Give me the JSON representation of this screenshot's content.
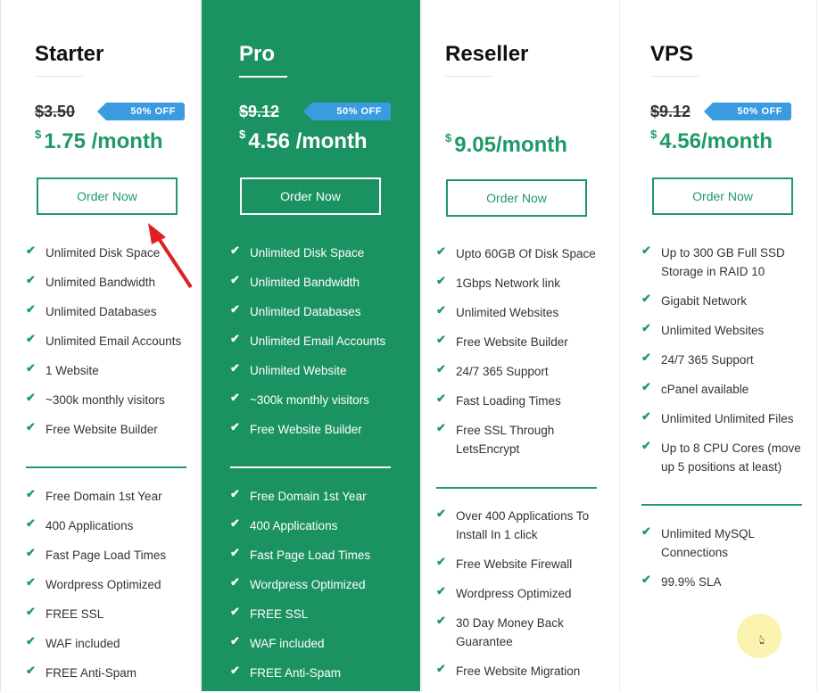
{
  "plans": [
    {
      "title": "Starter",
      "old_price": "$3.50",
      "badge": "50% OFF",
      "currency": "$",
      "price": "1.75 /month",
      "button": "Order Now",
      "features": [
        "Unlimited Disk Space",
        "Unlimited Bandwidth",
        "Unlimited Databases",
        "Unlimited Email Accounts",
        "1 Website",
        "~300k monthly visitors",
        "Free Website Builder"
      ],
      "extras": [
        "Free Domain 1st Year",
        "400 Applications",
        "Fast Page Load Times",
        "Wordpress Optimized",
        "FREE SSL",
        "WAF included",
        "FREE Anti-Spam"
      ]
    },
    {
      "title": "Pro",
      "old_price": "$9.12",
      "badge": "50% OFF",
      "currency": "$",
      "price": "4.56 /month",
      "button": "Order Now",
      "features": [
        "Unlimited Disk Space",
        "Unlimited Bandwidth",
        "Unlimited Databases",
        "Unlimited Email Accounts",
        "Unlimited Website",
        "~300k monthly visitors",
        "Free Website Builder"
      ],
      "extras": [
        "Free Domain 1st Year",
        "400 Applications",
        "Fast Page Load Times",
        "Wordpress Optimized",
        "FREE SSL",
        "WAF included",
        "FREE Anti-Spam"
      ]
    },
    {
      "title": "Reseller",
      "currency": "$",
      "price": "9.05/month",
      "button": "Order Now",
      "features": [
        "Upto 60GB Of Disk Space",
        "1Gbps Network link",
        "Unlimited Websites",
        "Free Website Builder",
        "24/7 365 Support",
        "Fast Loading Times",
        "Free SSL Through LetsEncrypt"
      ],
      "extras": [
        "Over 400 Applications To Install In 1 click",
        "Free Website Firewall",
        "Wordpress Optimized",
        "30 Day Money Back Guarantee",
        "Free Website Migration"
      ]
    },
    {
      "title": "VPS",
      "old_price": "$9.12",
      "badge": "50% OFF",
      "currency": "$",
      "price": "4.56/month",
      "button": "Order Now",
      "features": [
        "Up to 300 GB Full SSD Storage in RAID 10",
        "Gigabit Network",
        "Unlimited Websites",
        "24/7 365 Support",
        "cPanel available",
        "Unlimited Unlimited Files",
        "Up to 8 CPU Cores (move up 5 positions at least)"
      ],
      "extras": [
        "Unlimited MySQL Connections",
        "99.9% SLA"
      ]
    }
  ],
  "colors": {
    "accent": "#1f9a66",
    "pro_bg": "#1b9261",
    "badge": "#3a9be0",
    "annotation_arrow": "#e02020"
  }
}
